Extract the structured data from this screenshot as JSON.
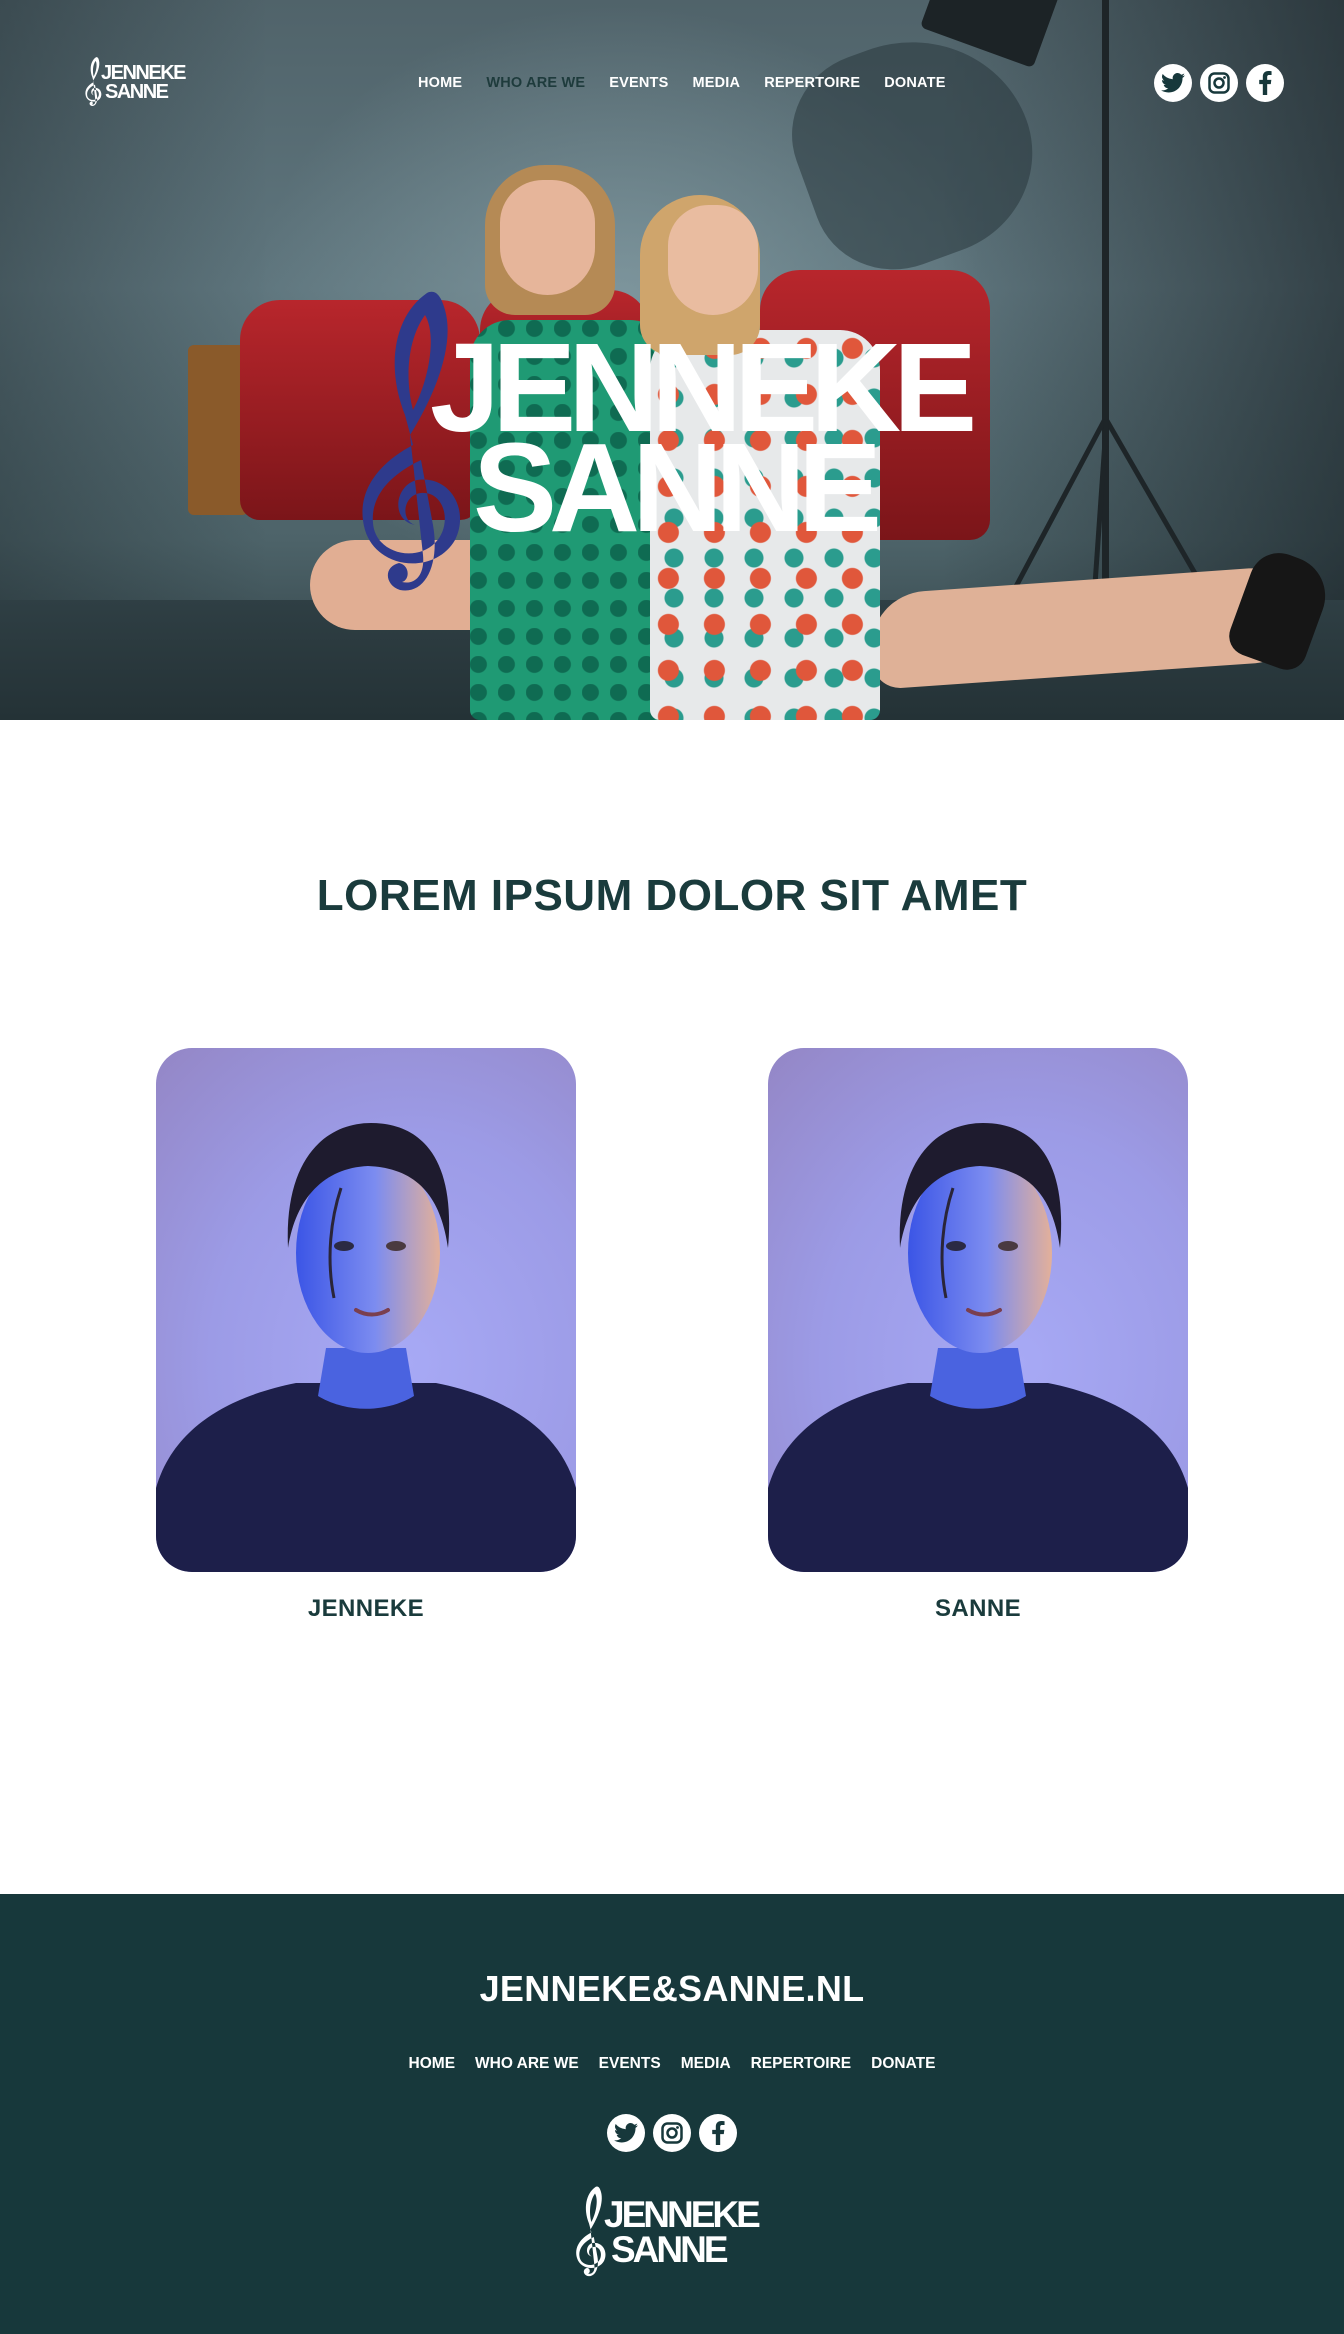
{
  "site": {
    "logo_line1": "JENNEKE",
    "logo_line2": "SANNE"
  },
  "nav": {
    "items": [
      {
        "label": "HOME",
        "active": false
      },
      {
        "label": "WHO ARE WE",
        "active": true
      },
      {
        "label": "EVENTS",
        "active": false
      },
      {
        "label": "MEDIA",
        "active": false
      },
      {
        "label": "REPERTOIRE",
        "active": false
      },
      {
        "label": "DONATE",
        "active": false
      }
    ],
    "social": [
      "twitter-icon",
      "instagram-icon",
      "facebook-icon"
    ]
  },
  "hero": {
    "logo_line1": "JENNEKE",
    "logo_line2": "SANNE"
  },
  "intro": {
    "title": "LOREM IPSUM DOLOR SIT AMET"
  },
  "members": [
    {
      "name": "JENNEKE"
    },
    {
      "name": "SANNE"
    }
  ],
  "footer": {
    "domain": "JENNEKE&SANNE.NL",
    "menu": [
      "HOME",
      "WHO ARE WE",
      "EVENTS",
      "MEDIA",
      "REPERTOIRE",
      "DONATE"
    ],
    "logo_line1": "JENNEKE",
    "logo_line2": "SANNE"
  },
  "colors": {
    "brand_dark": "#17383b",
    "heading": "#1a3b3c",
    "clef_blue": "#2e3a8c",
    "white": "#ffffff"
  }
}
